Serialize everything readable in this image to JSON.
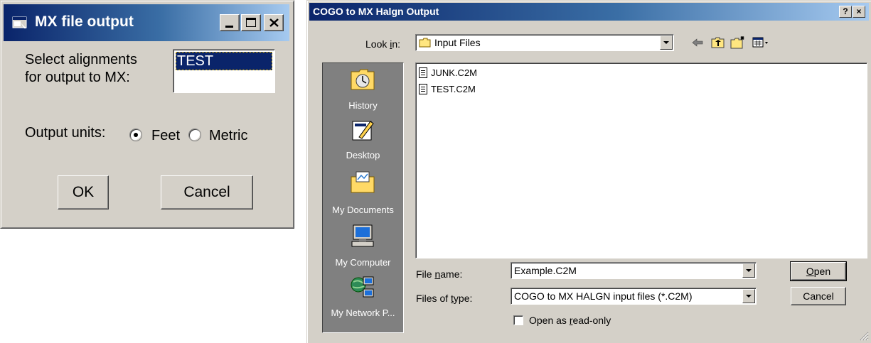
{
  "mx_dialog": {
    "title": "MX file output",
    "select_label_line1": "Select alignments",
    "select_label_line2": "for output to MX:",
    "alignments": [
      "TEST"
    ],
    "selected_alignment": "TEST",
    "units_label": "Output units:",
    "unit_options": [
      "Feet",
      "Metric"
    ],
    "selected_unit": "Feet",
    "ok_label": "OK",
    "cancel_label": "Cancel",
    "caption_buttons": [
      "minimize",
      "maximize",
      "close"
    ]
  },
  "open_dialog": {
    "title": "COGO to MX Halgn Output",
    "caption_buttons": [
      "?",
      "×"
    ],
    "look_in_label": "Look in:",
    "look_in_value": "Input Files",
    "toolbar_icons": [
      "back-arrow-icon",
      "up-folder-icon",
      "new-folder-icon",
      "view-menu-icon"
    ],
    "places": [
      {
        "label": "History",
        "icon": "history-icon"
      },
      {
        "label": "Desktop",
        "icon": "desktop-icon"
      },
      {
        "label": "My Documents",
        "icon": "my-documents-icon"
      },
      {
        "label": "My Computer",
        "icon": "my-computer-icon"
      },
      {
        "label": "My Network P...",
        "icon": "network-places-icon"
      }
    ],
    "files": [
      "JUNK.C2M",
      "TEST.C2M"
    ],
    "file_name_label": "File name:",
    "file_name_value": "Example.C2M",
    "files_of_type_label": "Files of type:",
    "files_of_type_value": "COGO to MX HALGN input files (*.C2M)",
    "read_only_label": "Open as read-only",
    "read_only_checked": false,
    "open_label": "Open",
    "cancel_label": "Cancel"
  },
  "colors": {
    "face": "#d4d0c8",
    "title_active": "#0a246a",
    "selection": "#0a246a",
    "places_bg": "#808080"
  }
}
